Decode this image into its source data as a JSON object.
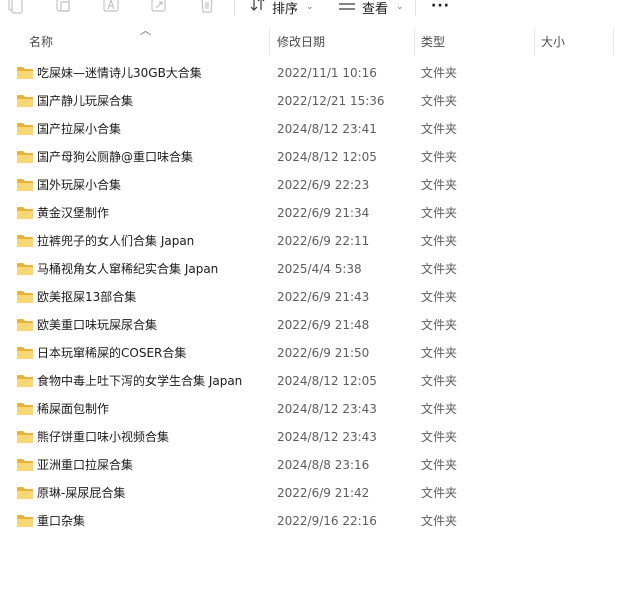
{
  "toolbar": {
    "sort_label": "排序",
    "view_label": "查看",
    "more_label": "···"
  },
  "columns": {
    "name": "名称",
    "date": "修改日期",
    "type": "类型",
    "size": "大小"
  },
  "files": [
    {
      "name": "吃屎妹—迷情诗儿30GB大合集",
      "date": "2022/11/1 10:16",
      "type": "文件夹"
    },
    {
      "name": "国产静儿玩屎合集",
      "date": "2022/12/21 15:36",
      "type": "文件夹"
    },
    {
      "name": "国产拉屎小合集",
      "date": "2024/8/12 23:41",
      "type": "文件夹"
    },
    {
      "name": "国产母狗公厕静@重口味合集",
      "date": "2024/8/12 12:05",
      "type": "文件夹"
    },
    {
      "name": "国外玩屎小合集",
      "date": "2022/6/9 22:23",
      "type": "文件夹"
    },
    {
      "name": "黄金汉堡制作",
      "date": "2022/6/9 21:34",
      "type": "文件夹"
    },
    {
      "name": "拉裤兜子的女人们合集 Japan",
      "date": "2022/6/9 22:11",
      "type": "文件夹"
    },
    {
      "name": "马桶视角女人窜稀纪实合集 Japan",
      "date": "2025/4/4 5:38",
      "type": "文件夹"
    },
    {
      "name": "欧美抠屎13部合集",
      "date": "2022/6/9 21:43",
      "type": "文件夹"
    },
    {
      "name": "欧美重口味玩屎尿合集",
      "date": "2022/6/9 21:48",
      "type": "文件夹"
    },
    {
      "name": "日本玩窜稀屎的COSER合集",
      "date": "2022/6/9 21:50",
      "type": "文件夹"
    },
    {
      "name": "食物中毒上吐下泻的女学生合集 Japan",
      "date": "2024/8/12 12:05",
      "type": "文件夹"
    },
    {
      "name": "稀屎面包制作",
      "date": "2024/8/12 23:43",
      "type": "文件夹"
    },
    {
      "name": "熊仔饼重口味小视频合集",
      "date": "2024/8/12 23:43",
      "type": "文件夹"
    },
    {
      "name": "亚洲重口拉屎合集",
      "date": "2024/8/8 23:16",
      "type": "文件夹"
    },
    {
      "name": "原琳-屎尿屁合集",
      "date": "2022/6/9 21:42",
      "type": "文件夹"
    },
    {
      "name": "重口杂集",
      "date": "2022/9/16 22:16",
      "type": "文件夹"
    }
  ],
  "colors": {
    "folder_fill": "#f8d775",
    "folder_tab": "#e8b33a",
    "header_text": "#4c4c4c",
    "secondary_text": "#5d5d5d"
  },
  "icons": [
    "copy-icon",
    "paste-icon",
    "rename-icon",
    "share-icon",
    "delete-icon",
    "sort-icon",
    "view-icon",
    "more-icon",
    "folder-icon"
  ]
}
